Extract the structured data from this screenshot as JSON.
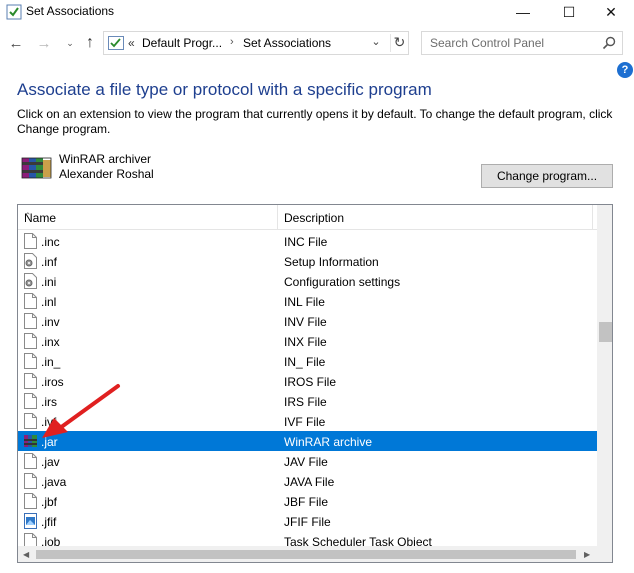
{
  "window": {
    "title": "Set Associations",
    "minimize": "—",
    "maximize": "☐",
    "close": "✕"
  },
  "nav": {
    "back": "←",
    "forward": "→",
    "recent": "⌄",
    "up": "↑",
    "address_prefix": "«",
    "crumb_1": "Default Progr...",
    "crumb_arrow": "›",
    "crumb_2": "Set Associations",
    "dropdown": "⌄",
    "refresh": "↻",
    "search_placeholder": "Search Control Panel"
  },
  "help": "?",
  "content": {
    "heading": "Associate a file type or protocol with a specific program",
    "description": "Click on an extension to view the program that currently opens it by default. To change the default program, click Change program.",
    "program_name": "WinRAR archiver",
    "program_vendor": "Alexander Roshal",
    "change_button": "Change program..."
  },
  "list": {
    "col_name": "Name",
    "col_desc": "Description",
    "rows": [
      {
        "ext": ".inc",
        "desc": "INC File",
        "icon": "blank-file-icon"
      },
      {
        "ext": ".inf",
        "desc": "Setup Information",
        "icon": "settings-file-icon"
      },
      {
        "ext": ".ini",
        "desc": "Configuration settings",
        "icon": "settings-file-icon"
      },
      {
        "ext": ".inl",
        "desc": "INL File",
        "icon": "blank-file-icon"
      },
      {
        "ext": ".inv",
        "desc": "INV File",
        "icon": "blank-file-icon"
      },
      {
        "ext": ".inx",
        "desc": "INX File",
        "icon": "blank-file-icon"
      },
      {
        "ext": ".in_",
        "desc": "IN_ File",
        "icon": "blank-file-icon"
      },
      {
        "ext": ".iros",
        "desc": "IROS File",
        "icon": "blank-file-icon"
      },
      {
        "ext": ".irs",
        "desc": "IRS File",
        "icon": "blank-file-icon"
      },
      {
        "ext": ".ivf",
        "desc": "IVF File",
        "icon": "blank-file-icon"
      },
      {
        "ext": ".jar",
        "desc": "WinRAR archive",
        "icon": "winrar-icon",
        "selected": true
      },
      {
        "ext": ".jav",
        "desc": "JAV File",
        "icon": "blank-file-icon"
      },
      {
        "ext": ".java",
        "desc": "JAVA File",
        "icon": "blank-file-icon"
      },
      {
        "ext": ".jbf",
        "desc": "JBF File",
        "icon": "blank-file-icon"
      },
      {
        "ext": ".jfif",
        "desc": "JFIF File",
        "icon": "image-file-icon"
      },
      {
        "ext": ".job",
        "desc": "Task Scheduler Task Object",
        "icon": "blank-file-icon"
      }
    ]
  },
  "colors": {
    "heading": "#1e3f8f",
    "selection": "#0078d7",
    "annotation_arrow": "#e02020"
  }
}
